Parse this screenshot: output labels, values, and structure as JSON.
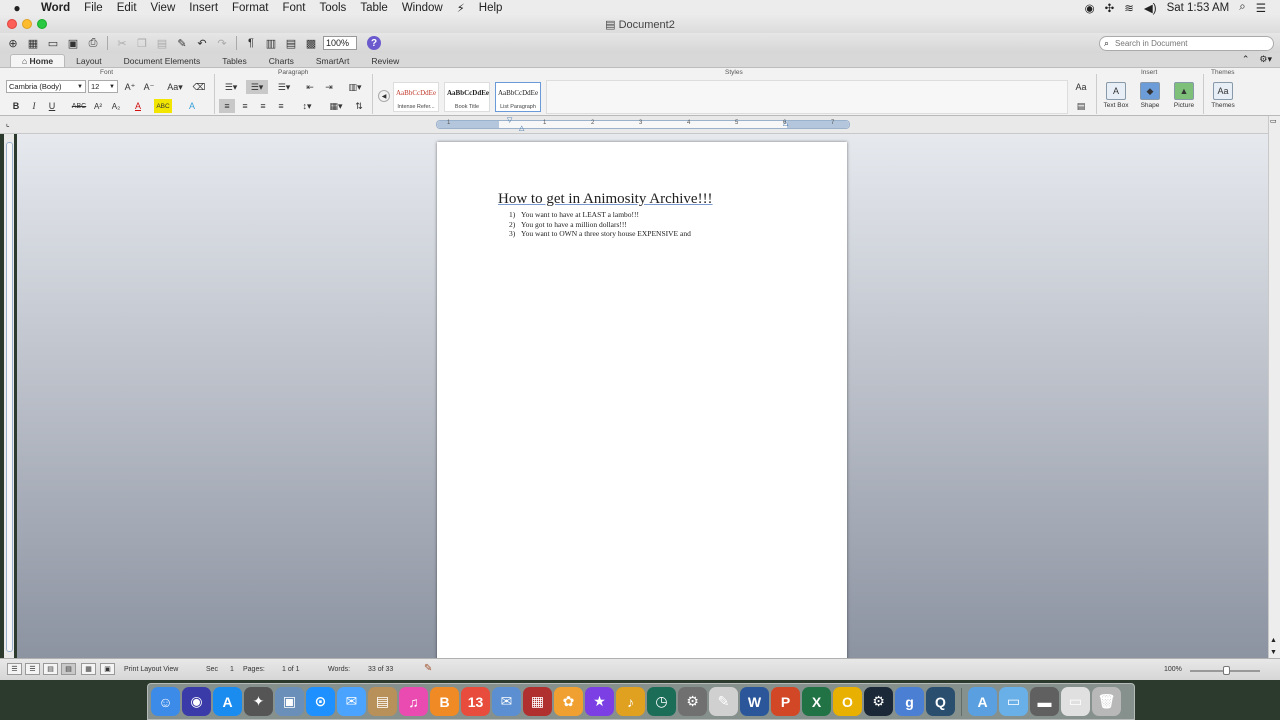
{
  "menubar": {
    "items": [
      "Word",
      "File",
      "Edit",
      "View",
      "Insert",
      "Format",
      "Font",
      "Tools",
      "Table",
      "Window",
      "Help"
    ],
    "clock": "Sat 1:53 AM"
  },
  "window": {
    "title": "Document2"
  },
  "toolbar": {
    "zoom": "100%",
    "search_placeholder": "Search in Document"
  },
  "ribbon": {
    "tabs": [
      "Home",
      "Layout",
      "Document Elements",
      "Tables",
      "Charts",
      "SmartArt",
      "Review"
    ],
    "groups": {
      "font": "Font",
      "paragraph": "Paragraph",
      "styles": "Styles",
      "insert": "Insert",
      "themes": "Themes"
    },
    "font_name": "Cambria (Body)",
    "font_size": "12",
    "styles": [
      {
        "sample": "AaBbCcDdEe",
        "name": "Intense Refer...",
        "color": "#c0392b"
      },
      {
        "sample": "AaBbCcDdEe",
        "name": "Book Title",
        "color": "#222222"
      },
      {
        "sample": "AaBbCcDdEe",
        "name": "List Paragraph",
        "color": "#222222"
      }
    ],
    "insert_buttons": [
      "Text Box",
      "Shape",
      "Picture"
    ],
    "themes_button": "Themes"
  },
  "ruler": {
    "numbers": [
      "1",
      "1",
      "2",
      "3",
      "4",
      "5",
      "6",
      "7"
    ]
  },
  "document": {
    "heading": "How to get in Animosity Archive!!!",
    "list": [
      {
        "num": "1)",
        "text": "You want to have at LEAST a lambo!!!"
      },
      {
        "num": "2)",
        "text": "You got to have a million dollars!!!"
      },
      {
        "num": "3)",
        "text": "You want to OWN a three story house EXPENSIVE  and"
      }
    ]
  },
  "statusbar": {
    "view": "Print Layout View",
    "sec_label": "Sec",
    "sec_value": "1",
    "pages_label": "Pages:",
    "pages_value": "1 of 1",
    "words_label": "Words:",
    "words_value": "33 of 33",
    "zoom": "100%"
  },
  "dock": {
    "apps": [
      {
        "name": "finder-icon",
        "glyph": "☺",
        "color": "#3c8be8"
      },
      {
        "name": "siri-icon",
        "glyph": "◉",
        "color": "#3a3aa8"
      },
      {
        "name": "app-store-icon",
        "glyph": "A",
        "color": "#1a8cf0"
      },
      {
        "name": "launchpad-icon",
        "glyph": "✦",
        "color": "#555555"
      },
      {
        "name": "preview-icon",
        "glyph": "▣",
        "color": "#6a8fb8"
      },
      {
        "name": "safari-icon",
        "glyph": "⊙",
        "color": "#1e90ff"
      },
      {
        "name": "messages-icon",
        "glyph": "✉",
        "color": "#4aa3ff"
      },
      {
        "name": "contacts-icon",
        "glyph": "▤",
        "color": "#b8905a"
      },
      {
        "name": "itunes-icon",
        "glyph": "♫",
        "color": "#e94bb0"
      },
      {
        "name": "ibooks-icon",
        "glyph": "B",
        "color": "#f08a24"
      },
      {
        "name": "calendar-icon",
        "glyph": "13",
        "color": "#e74c3c"
      },
      {
        "name": "mail-icon",
        "glyph": "✉",
        "color": "#5b8fd1"
      },
      {
        "name": "photo-booth-icon",
        "glyph": "▦",
        "color": "#b03030"
      },
      {
        "name": "photos-icon",
        "glyph": "✿",
        "color": "#f0a030"
      },
      {
        "name": "imovie-icon",
        "glyph": "★",
        "color": "#7b3fe4"
      },
      {
        "name": "garageband-icon",
        "glyph": "♪",
        "color": "#e0a020"
      },
      {
        "name": "time-machine-icon",
        "glyph": "◷",
        "color": "#1b6d58"
      },
      {
        "name": "system-preferences-icon",
        "glyph": "⚙",
        "color": "#707070"
      },
      {
        "name": "textedit-icon",
        "glyph": "✎",
        "color": "#d0d0d0"
      },
      {
        "name": "word-icon",
        "glyph": "W",
        "color": "#2b579a"
      },
      {
        "name": "powerpoint-icon",
        "glyph": "P",
        "color": "#d24726"
      },
      {
        "name": "excel-icon",
        "glyph": "X",
        "color": "#217346"
      },
      {
        "name": "outlook-icon",
        "glyph": "O",
        "color": "#e8b000"
      },
      {
        "name": "steam-icon",
        "glyph": "⚙",
        "color": "#1b2838"
      },
      {
        "name": "g-app-icon",
        "glyph": "g",
        "color": "#4a7fd4"
      },
      {
        "name": "quicktime-icon",
        "glyph": "Q",
        "color": "#2a4e6e"
      },
      {
        "name": "applications-folder-icon",
        "glyph": "A",
        "color": "#5aa0e0"
      },
      {
        "name": "documents-folder-icon",
        "glyph": "▭",
        "color": "#6ab0e8"
      },
      {
        "name": "screenshot-icon",
        "glyph": "▬",
        "color": "#606060"
      },
      {
        "name": "desktop-item-icon",
        "glyph": "▭",
        "color": "#e0e0e0"
      },
      {
        "name": "trash-icon",
        "glyph": "🗑",
        "color": "#b8b8b8"
      }
    ]
  }
}
